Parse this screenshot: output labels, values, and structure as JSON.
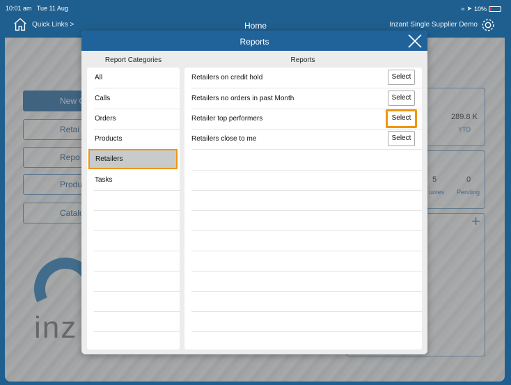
{
  "status_bar": {
    "time": "10:01 am",
    "date": "Tue 11 Aug",
    "battery": "10%"
  },
  "nav": {
    "quick_links": "Quick Links >",
    "title": "Home",
    "supplier": "Inzant Single Supplier Demo"
  },
  "background": {
    "buttons": [
      "New C",
      "Retai",
      "Repo",
      "Produ",
      "Catalo"
    ],
    "stats": {
      "ytd_value": "289.8 K",
      "ytd_label": "YTD",
      "quotes_value": "5",
      "quotes_label": "uotes",
      "pending_value": "0",
      "pending_label": "Pending"
    },
    "logo_text": "inz"
  },
  "modal": {
    "title": "Reports",
    "categories_heading": "Report Categories",
    "reports_heading": "Reports",
    "categories": [
      "All",
      "Calls",
      "Orders",
      "Products",
      "Retailers",
      "Tasks"
    ],
    "selected_category": "Retailers",
    "reports": [
      {
        "label": "Retailers on credit hold",
        "button": "Select"
      },
      {
        "label": "Retailers no orders in past Month",
        "button": "Select"
      },
      {
        "label": "Retailer top performers",
        "button": "Select"
      },
      {
        "label": "Retailers close to me",
        "button": "Select"
      }
    ],
    "highlighted_report": "Retailer top performers"
  },
  "colors": {
    "header_blue": "#20639b",
    "highlight_orange": "#f0960f",
    "selected_gray": "#c9cacc"
  }
}
